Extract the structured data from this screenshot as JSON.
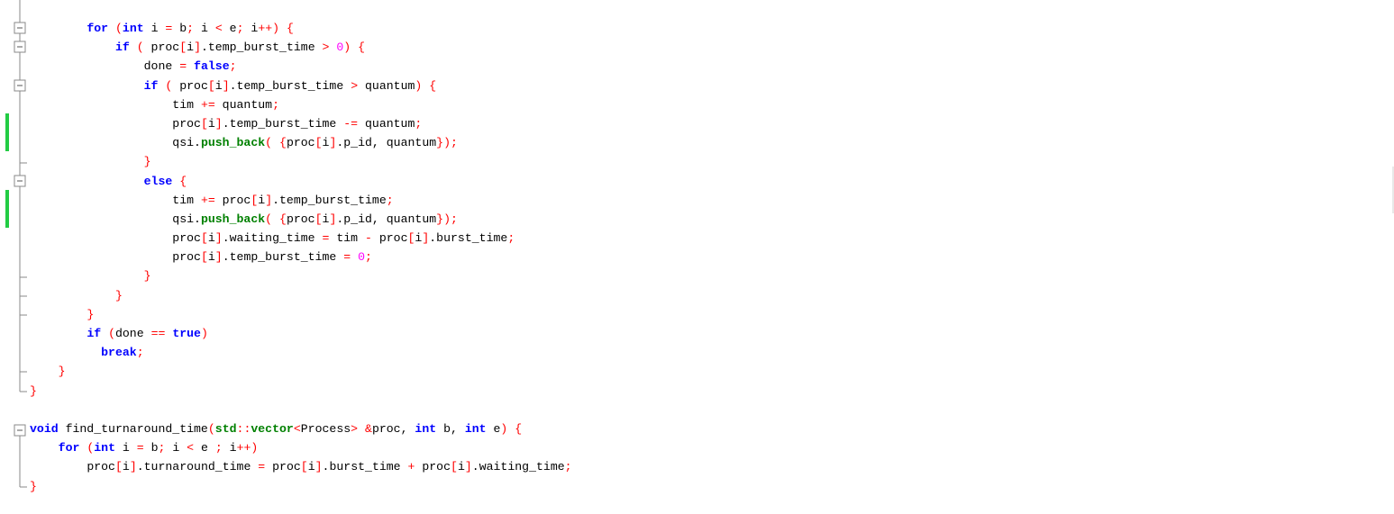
{
  "editor": {
    "colors": {
      "keyword": "#0000ff",
      "operator": "#ff0000",
      "number": "#ff00ff",
      "function": "#008000",
      "identifier": "#000000",
      "change_marker": "#22cc44"
    },
    "lines": [
      {
        "tokens": [
          [
            "ws",
            "        "
          ],
          [
            "kw",
            "for"
          ],
          [
            "ws",
            " "
          ],
          [
            "op",
            "("
          ],
          [
            "kw",
            "int"
          ],
          [
            "id",
            " i "
          ],
          [
            "op",
            "="
          ],
          [
            "id",
            " b"
          ],
          [
            "op",
            ";"
          ],
          [
            "id",
            " i "
          ],
          [
            "op",
            "<"
          ],
          [
            "id",
            " e"
          ],
          [
            "op",
            ";"
          ],
          [
            "id",
            " i"
          ],
          [
            "op",
            "++)"
          ],
          [
            "ws",
            " "
          ],
          [
            "op",
            "{"
          ]
        ]
      },
      {
        "tokens": [
          [
            "ws",
            "            "
          ],
          [
            "kw",
            "if"
          ],
          [
            "ws",
            " "
          ],
          [
            "op",
            "("
          ],
          [
            "id",
            " proc"
          ],
          [
            "op",
            "["
          ],
          [
            "id",
            "i"
          ],
          [
            "op",
            "]"
          ],
          [
            "id",
            ".temp_burst_time "
          ],
          [
            "op",
            ">"
          ],
          [
            "ws",
            " "
          ],
          [
            "num",
            "0"
          ],
          [
            "op",
            ")"
          ],
          [
            "ws",
            " "
          ],
          [
            "op",
            "{"
          ]
        ]
      },
      {
        "tokens": [
          [
            "ws",
            "                "
          ],
          [
            "id",
            "done "
          ],
          [
            "op",
            "="
          ],
          [
            "ws",
            " "
          ],
          [
            "kw",
            "false"
          ],
          [
            "op",
            ";"
          ]
        ]
      },
      {
        "tokens": [
          [
            "ws",
            "                "
          ],
          [
            "kw",
            "if"
          ],
          [
            "ws",
            " "
          ],
          [
            "op",
            "("
          ],
          [
            "id",
            " proc"
          ],
          [
            "op",
            "["
          ],
          [
            "id",
            "i"
          ],
          [
            "op",
            "]"
          ],
          [
            "id",
            ".temp_burst_time "
          ],
          [
            "op",
            ">"
          ],
          [
            "id",
            " quantum"
          ],
          [
            "op",
            ")"
          ],
          [
            "ws",
            " "
          ],
          [
            "op",
            "{"
          ]
        ]
      },
      {
        "tokens": [
          [
            "ws",
            "                    "
          ],
          [
            "id",
            "tim "
          ],
          [
            "op",
            "+="
          ],
          [
            "id",
            " quantum"
          ],
          [
            "op",
            ";"
          ]
        ]
      },
      {
        "tokens": [
          [
            "ws",
            "                    "
          ],
          [
            "id",
            "proc"
          ],
          [
            "op",
            "["
          ],
          [
            "id",
            "i"
          ],
          [
            "op",
            "]"
          ],
          [
            "id",
            ".temp_burst_time "
          ],
          [
            "op",
            "-="
          ],
          [
            "id",
            " quantum"
          ],
          [
            "op",
            ";"
          ]
        ]
      },
      {
        "tokens": [
          [
            "ws",
            "                    "
          ],
          [
            "id",
            "qsi."
          ],
          [
            "fn",
            "push_back"
          ],
          [
            "op",
            "("
          ],
          [
            "ws",
            " "
          ],
          [
            "op",
            "{"
          ],
          [
            "id",
            "proc"
          ],
          [
            "op",
            "["
          ],
          [
            "id",
            "i"
          ],
          [
            "op",
            "]"
          ],
          [
            "id",
            ".p_id, quantum"
          ],
          [
            "op",
            "});"
          ]
        ]
      },
      {
        "tokens": [
          [
            "ws",
            "                "
          ],
          [
            "op",
            "}"
          ]
        ]
      },
      {
        "tokens": [
          [
            "ws",
            "                "
          ],
          [
            "kw",
            "else"
          ],
          [
            "ws",
            " "
          ],
          [
            "op",
            "{"
          ]
        ]
      },
      {
        "tokens": [
          [
            "ws",
            "                    "
          ],
          [
            "id",
            "tim "
          ],
          [
            "op",
            "+="
          ],
          [
            "id",
            " proc"
          ],
          [
            "op",
            "["
          ],
          [
            "id",
            "i"
          ],
          [
            "op",
            "]"
          ],
          [
            "id",
            ".temp_burst_time"
          ],
          [
            "op",
            ";"
          ]
        ]
      },
      {
        "tokens": [
          [
            "ws",
            "                    "
          ],
          [
            "id",
            "qsi."
          ],
          [
            "fn",
            "push_back"
          ],
          [
            "op",
            "("
          ],
          [
            "ws",
            " "
          ],
          [
            "op",
            "{"
          ],
          [
            "id",
            "proc"
          ],
          [
            "op",
            "["
          ],
          [
            "id",
            "i"
          ],
          [
            "op",
            "]"
          ],
          [
            "id",
            ".p_id, quantum"
          ],
          [
            "op",
            "});"
          ]
        ]
      },
      {
        "tokens": [
          [
            "ws",
            "                    "
          ],
          [
            "id",
            "proc"
          ],
          [
            "op",
            "["
          ],
          [
            "id",
            "i"
          ],
          [
            "op",
            "]"
          ],
          [
            "id",
            ".waiting_time "
          ],
          [
            "op",
            "="
          ],
          [
            "id",
            " tim "
          ],
          [
            "op",
            "-"
          ],
          [
            "id",
            " proc"
          ],
          [
            "op",
            "["
          ],
          [
            "id",
            "i"
          ],
          [
            "op",
            "]"
          ],
          [
            "id",
            ".burst_time"
          ],
          [
            "op",
            ";"
          ]
        ]
      },
      {
        "tokens": [
          [
            "ws",
            "                    "
          ],
          [
            "id",
            "proc"
          ],
          [
            "op",
            "["
          ],
          [
            "id",
            "i"
          ],
          [
            "op",
            "]"
          ],
          [
            "id",
            ".temp_burst_time "
          ],
          [
            "op",
            "="
          ],
          [
            "ws",
            " "
          ],
          [
            "num",
            "0"
          ],
          [
            "op",
            ";"
          ]
        ]
      },
      {
        "tokens": [
          [
            "ws",
            "                "
          ],
          [
            "op",
            "}"
          ]
        ]
      },
      {
        "tokens": [
          [
            "ws",
            "            "
          ],
          [
            "op",
            "}"
          ]
        ]
      },
      {
        "tokens": [
          [
            "ws",
            "        "
          ],
          [
            "op",
            "}"
          ]
        ]
      },
      {
        "tokens": [
          [
            "ws",
            "        "
          ],
          [
            "kw",
            "if"
          ],
          [
            "ws",
            " "
          ],
          [
            "op",
            "("
          ],
          [
            "id",
            "done "
          ],
          [
            "op",
            "=="
          ],
          [
            "ws",
            " "
          ],
          [
            "kw",
            "true"
          ],
          [
            "op",
            ")"
          ]
        ]
      },
      {
        "tokens": [
          [
            "ws",
            "          "
          ],
          [
            "kw",
            "break"
          ],
          [
            "op",
            ";"
          ]
        ]
      },
      {
        "tokens": [
          [
            "ws",
            "    "
          ],
          [
            "op",
            "}"
          ]
        ]
      },
      {
        "tokens": [
          [
            "op",
            "}"
          ]
        ]
      },
      {
        "tokens": []
      },
      {
        "tokens": [
          [
            "kw",
            "void"
          ],
          [
            "id",
            " find_turnaround_time"
          ],
          [
            "op",
            "("
          ],
          [
            "cls",
            "std"
          ],
          [
            "op",
            "::"
          ],
          [
            "cls",
            "vector"
          ],
          [
            "op",
            "<"
          ],
          [
            "id",
            "Process"
          ],
          [
            "op",
            ">"
          ],
          [
            "ws",
            " "
          ],
          [
            "op",
            "&"
          ],
          [
            "id",
            "proc, "
          ],
          [
            "kw",
            "int"
          ],
          [
            "id",
            " b, "
          ],
          [
            "kw",
            "int"
          ],
          [
            "id",
            " e"
          ],
          [
            "op",
            ")"
          ],
          [
            "ws",
            " "
          ],
          [
            "op",
            "{"
          ]
        ]
      },
      {
        "tokens": [
          [
            "ws",
            "    "
          ],
          [
            "kw",
            "for"
          ],
          [
            "ws",
            " "
          ],
          [
            "op",
            "("
          ],
          [
            "kw",
            "int"
          ],
          [
            "id",
            " i "
          ],
          [
            "op",
            "="
          ],
          [
            "id",
            " b"
          ],
          [
            "op",
            ";"
          ],
          [
            "id",
            " i "
          ],
          [
            "op",
            "<"
          ],
          [
            "id",
            " e "
          ],
          [
            "op",
            ";"
          ],
          [
            "id",
            " i"
          ],
          [
            "op",
            "++)"
          ]
        ]
      },
      {
        "tokens": [
          [
            "ws",
            "        "
          ],
          [
            "id",
            "proc"
          ],
          [
            "op",
            "["
          ],
          [
            "id",
            "i"
          ],
          [
            "op",
            "]"
          ],
          [
            "id",
            ".turnaround_time "
          ],
          [
            "op",
            "="
          ],
          [
            "id",
            " proc"
          ],
          [
            "op",
            "["
          ],
          [
            "id",
            "i"
          ],
          [
            "op",
            "]"
          ],
          [
            "id",
            ".burst_time "
          ],
          [
            "op",
            "+"
          ],
          [
            "id",
            " proc"
          ],
          [
            "op",
            "["
          ],
          [
            "id",
            "i"
          ],
          [
            "op",
            "]"
          ],
          [
            "id",
            ".waiting_time"
          ],
          [
            "op",
            ";"
          ]
        ]
      },
      {
        "tokens": [
          [
            "op",
            "}"
          ]
        ]
      }
    ]
  }
}
